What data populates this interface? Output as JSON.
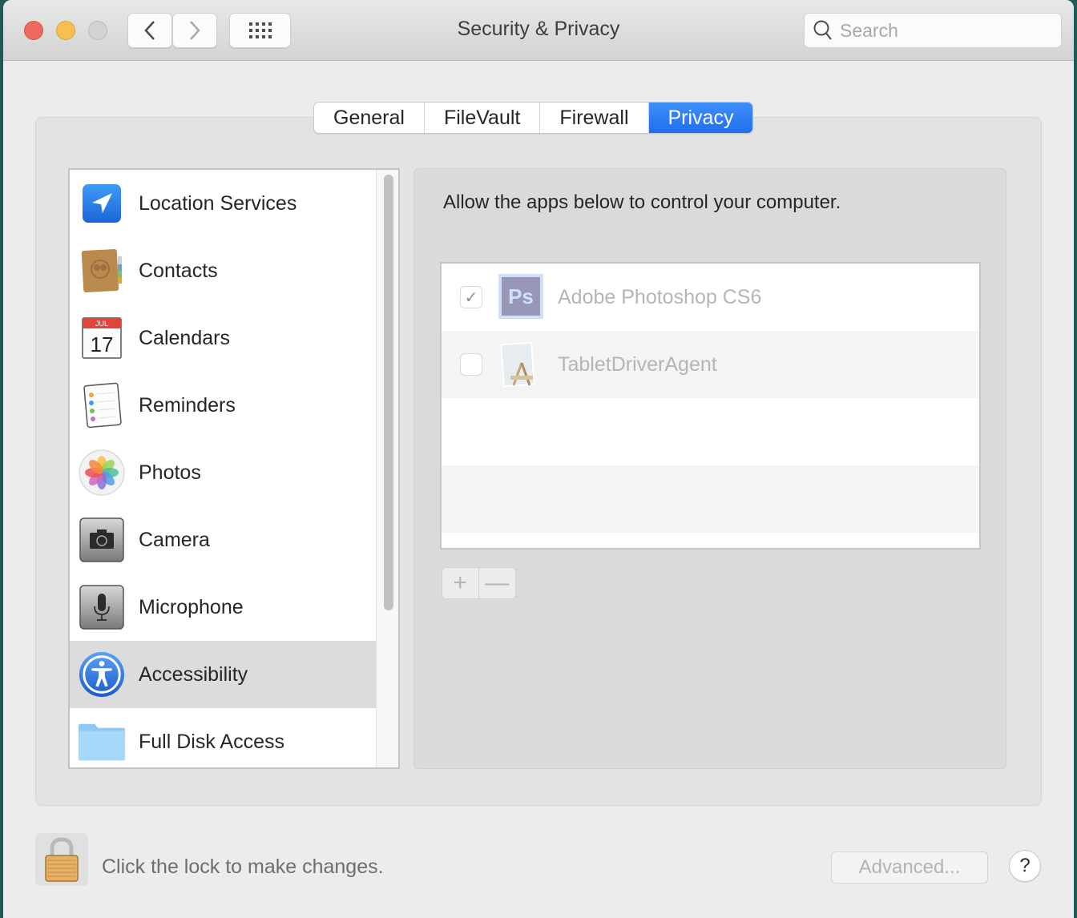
{
  "window": {
    "title": "Security & Privacy",
    "search_placeholder": "Search"
  },
  "toolbar": {
    "back": "back",
    "forward": "forward",
    "show_all": "show-all"
  },
  "tabs": [
    {
      "label": "General",
      "active": false
    },
    {
      "label": "FileVault",
      "active": false
    },
    {
      "label": "Firewall",
      "active": false
    },
    {
      "label": "Privacy",
      "active": true
    }
  ],
  "privacy_categories": [
    {
      "label": "Location Services",
      "icon": "location-icon",
      "selected": false
    },
    {
      "label": "Contacts",
      "icon": "contacts-icon",
      "selected": false
    },
    {
      "label": "Calendars",
      "icon": "calendar-icon",
      "selected": false,
      "icon_month": "JUL",
      "icon_day": "17"
    },
    {
      "label": "Reminders",
      "icon": "reminders-icon",
      "selected": false
    },
    {
      "label": "Photos",
      "icon": "photos-icon",
      "selected": false
    },
    {
      "label": "Camera",
      "icon": "camera-icon",
      "selected": false
    },
    {
      "label": "Microphone",
      "icon": "microphone-icon",
      "selected": false
    },
    {
      "label": "Accessibility",
      "icon": "accessibility-icon",
      "selected": true
    },
    {
      "label": "Full Disk Access",
      "icon": "folder-icon",
      "selected": false
    }
  ],
  "detail": {
    "heading": "Allow the apps below to control your computer.",
    "apps": [
      {
        "name": "Adobe Photoshop CS6",
        "checked": true,
        "icon": "photoshop-icon",
        "icon_text": "Ps"
      },
      {
        "name": "TabletDriverAgent",
        "checked": false,
        "icon": "application-icon"
      }
    ],
    "add_button": "+",
    "remove_button": "—"
  },
  "footer": {
    "lock_text": "Click the lock to make changes.",
    "advanced_button": "Advanced...",
    "help_button": "?"
  },
  "colors": {
    "accent": "#2a7bf4",
    "close": "#ee6a5e",
    "minimize": "#f5c04f",
    "zoom_disabled": "#d3d3d3"
  }
}
